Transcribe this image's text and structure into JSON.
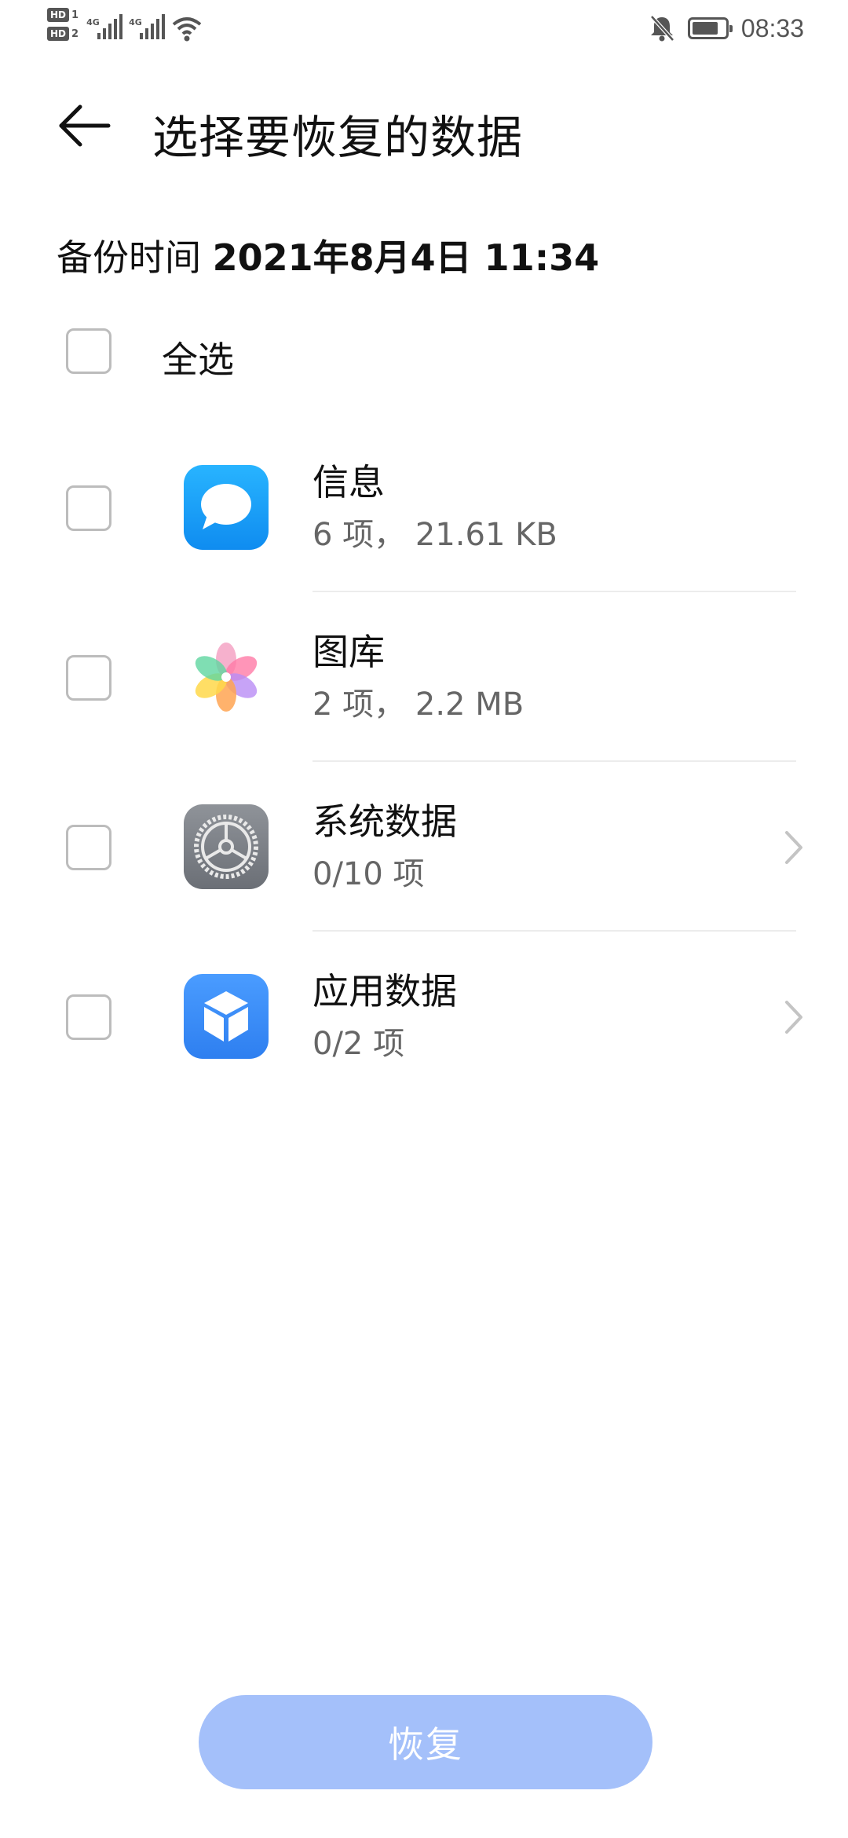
{
  "status_bar": {
    "sim1": "HD",
    "sim1_num": "1",
    "sim2": "HD",
    "sim2_num": "2",
    "signal1_label": "4G",
    "signal2_label": "4G",
    "wifi_icon": "wifi-icon",
    "mute_icon": "bell-off-icon",
    "battery_icon": "battery-icon",
    "time": "08:33"
  },
  "header": {
    "back_icon": "arrow-left-icon",
    "title": "选择要恢复的数据"
  },
  "backup": {
    "label": "备份时间",
    "value": "2021年8月4日 11:34"
  },
  "select_all": {
    "label": "全选",
    "checked": false
  },
  "items": [
    {
      "name": "信息",
      "detail": "6 项， 21.61 KB",
      "icon": "messages-icon",
      "color": "#1aa3f5",
      "checked": false,
      "has_chevron": false
    },
    {
      "name": "图库",
      "detail": "2 项， 2.2 MB",
      "icon": "gallery-icon",
      "checked": false,
      "has_chevron": false
    },
    {
      "name": "系统数据",
      "detail": "0/10 项",
      "icon": "settings-icon",
      "color": "#7b7f86",
      "checked": false,
      "has_chevron": true
    },
    {
      "name": "应用数据",
      "detail": "0/2 项",
      "icon": "app-cube-icon",
      "color": "#3d8ef5",
      "checked": false,
      "has_chevron": true
    }
  ],
  "restore_button": {
    "label": "恢复",
    "color": "#a4c0fa",
    "enabled": false
  }
}
